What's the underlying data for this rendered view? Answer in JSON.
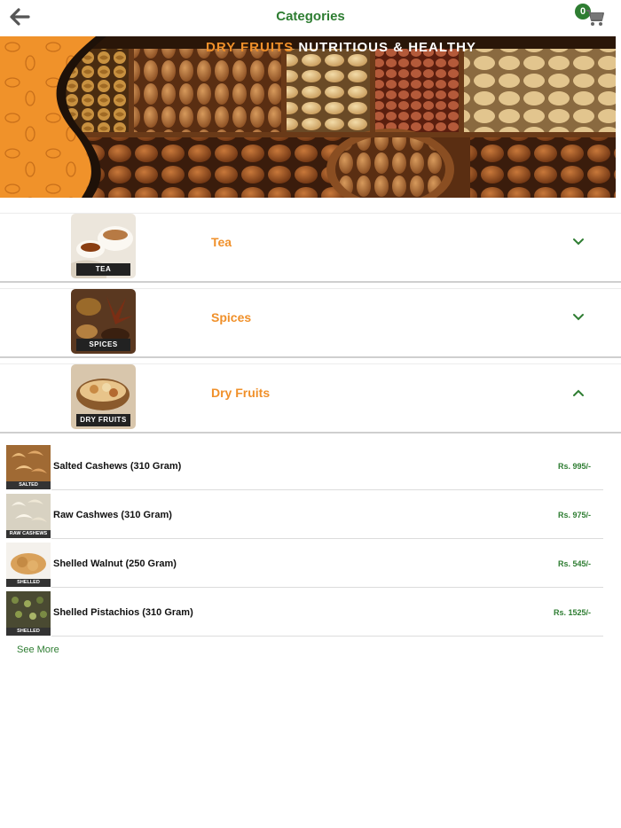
{
  "colors": {
    "accent": "#2e7d32",
    "category": "#f0902a",
    "arrow": "#555555"
  },
  "header": {
    "title": "Categories",
    "back_icon": "arrow-left-icon",
    "cart_icon": "cart-icon",
    "cart_count": "0"
  },
  "banner": {
    "caption_highlight": "DRY FRUITS",
    "caption_rest": "NUTRITIOUS & HEALTHY"
  },
  "categories": [
    {
      "name": "Tea",
      "thumb_label": "TEA",
      "expanded": false
    },
    {
      "name": "Spices",
      "thumb_label": "SPICES",
      "expanded": false
    },
    {
      "name": "Dry Fruits",
      "thumb_label": "DRY FRUITS",
      "expanded": true
    }
  ],
  "products": [
    {
      "name": "Salted Cashews (310 Gram)",
      "price": "Rs. 995/-",
      "thumb_label": "SALTED CASHEWS"
    },
    {
      "name": "Raw Cashwes (310 Gram)",
      "price": "Rs. 975/-",
      "thumb_label": "RAW CASHEWS"
    },
    {
      "name": "Shelled Walnut (250 Gram)",
      "price": "Rs. 545/-",
      "thumb_label": "SHELLED WALNUTS"
    },
    {
      "name": "Shelled Pistachios (310 Gram)",
      "price": "Rs. 1525/-",
      "thumb_label": "SHELLED PISTACHIOS"
    }
  ],
  "see_more": "See More"
}
